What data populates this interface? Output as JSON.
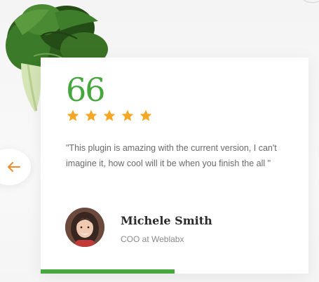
{
  "testimonial": {
    "quote_mark": "66",
    "rating": 5,
    "rating_max": 5,
    "text": "\"This plugin is amazing with the current version, I can't imagine it, how cool will it be when you finish the all \"",
    "author": {
      "name": "Michele Smith",
      "role": "COO at Weblabx"
    }
  },
  "slider": {
    "progress_fraction": 0.5
  },
  "icons": {
    "prev": "arrow-left-icon",
    "star": "star-icon",
    "decor": "leaf-illustration"
  },
  "colors": {
    "accent_green": "#46a73f",
    "star_orange": "#f3a724",
    "arrow_orange": "#f28c2c",
    "card_bg": "#ffffff",
    "text_gray": "#6a6a6a",
    "name_dark": "#2a2a2a"
  }
}
